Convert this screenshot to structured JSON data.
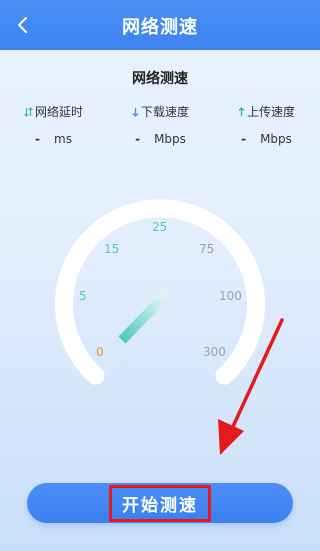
{
  "header": {
    "title": "网络测速"
  },
  "panel": {
    "title": "网络测速"
  },
  "metrics": [
    {
      "label": "网络延时",
      "value": "-",
      "unit": "ms",
      "icon": "updown-arrows-icon"
    },
    {
      "label": "下载速度",
      "value": "-",
      "unit": "Mbps",
      "icon": "download-arrow-icon"
    },
    {
      "label": "上传速度",
      "value": "-",
      "unit": "Mbps",
      "icon": "upload-arrow-icon"
    }
  ],
  "gauge": {
    "ticks": [
      "0",
      "5",
      "15",
      "25",
      "75",
      "100",
      "300"
    ],
    "current_value": 0
  },
  "action": {
    "start_label": "开始测速"
  },
  "colors": {
    "accent": "#3d84f2",
    "tick_active": "#55c4c8",
    "tick_zero": "#f0962e",
    "tick_inactive": "#9aa0a8",
    "highlight": "#e31b1b"
  }
}
